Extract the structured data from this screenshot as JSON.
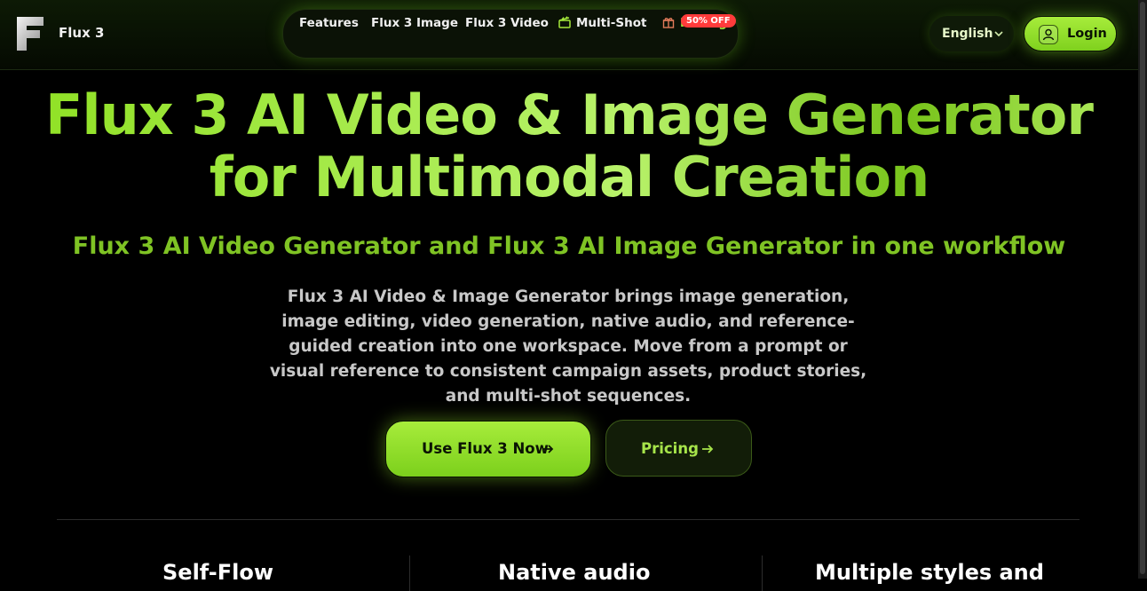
{
  "header": {
    "brand_name": "Flux 3",
    "logo_icon": "flux-f-logo",
    "nav": [
      {
        "label": "Features",
        "icon": null
      },
      {
        "label": "Flux 3 Image",
        "icon": null
      },
      {
        "label": "Flux 3 Video",
        "icon": null
      },
      {
        "label": "Multi-Shot",
        "icon": "clapperboard-icon"
      },
      {
        "label": "Pricing",
        "icon": "gift-icon",
        "badge": "50% OFF"
      }
    ],
    "language": "English",
    "login_label": "Login"
  },
  "hero": {
    "title_line1": "Flux 3 AI Video & Image Generator",
    "title_line2": "for Multimodal Creation",
    "subtitle": "Flux 3 AI Video Generator and Flux 3 AI Image Generator in one workflow",
    "description": "Flux 3 AI Video & Image Generator brings image generation, image editing, video generation, native audio, and reference-guided creation into one workspace. Move from a prompt or visual reference to consistent campaign assets, product stories, and multi-shot sequences.",
    "primary_cta": "Use Flux 3 Now",
    "secondary_cta": "Pricing"
  },
  "features": [
    "Self-Flow",
    "Native audio",
    "Multiple styles and"
  ],
  "colors": {
    "accent": "#9be23a",
    "badge": "#ff3b3b",
    "background": "#000000"
  }
}
